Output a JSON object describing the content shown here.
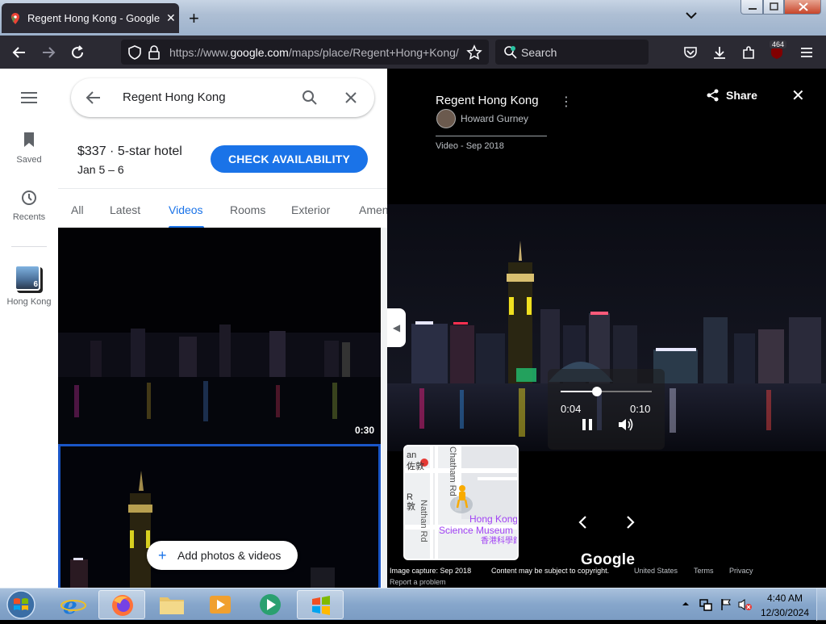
{
  "browser": {
    "tab_title": "Regent Hong Kong - Google Maps",
    "url_prefix": "https://www.",
    "url_domain": "google.com",
    "url_path": "/maps/place/Regent+Hong+Kong/",
    "search_placeholder": "Search",
    "extension_badge": "464"
  },
  "rail": {
    "saved_label": "Saved",
    "recents_label": "Recents",
    "place_label": "Hong Kong",
    "place_count": "6"
  },
  "panel": {
    "search_value": "Regent Hong Kong",
    "price_line": "$337 · 5-star hotel",
    "dates": "Jan 5 – 6",
    "check_button": "CHECK AVAILABILITY",
    "tabs": [
      "All",
      "Latest",
      "Videos",
      "Rooms",
      "Exterior",
      "Amenities"
    ],
    "selected_tab": "Videos",
    "video_duration": "0:30",
    "add_button": "Add photos & videos"
  },
  "viewer": {
    "title": "Regent Hong Kong",
    "author": "Howard Gurney",
    "date": "Video - Sep 2018",
    "share_label": "Share",
    "current_time": "0:04",
    "total_time": "0:10",
    "progress": 0.4,
    "map_labels": [
      "Hong Kong",
      "Science Museum",
      "香港科學館",
      "Nathan Rd",
      "Chatham Rd"
    ],
    "logo": "Google",
    "footer": {
      "capture": "Image capture: Sep 2018",
      "copyright": "Content may be subject to copyright.",
      "region": "United States",
      "terms": "Terms",
      "privacy": "Privacy",
      "report": "Report a problem"
    }
  },
  "taskbar": {
    "time": "4:40 AM",
    "date": "12/30/2024"
  },
  "colors": {
    "accent": "#1a73e8",
    "browser_dark": "#2b2a33",
    "selected_border": "#1a56c7"
  }
}
